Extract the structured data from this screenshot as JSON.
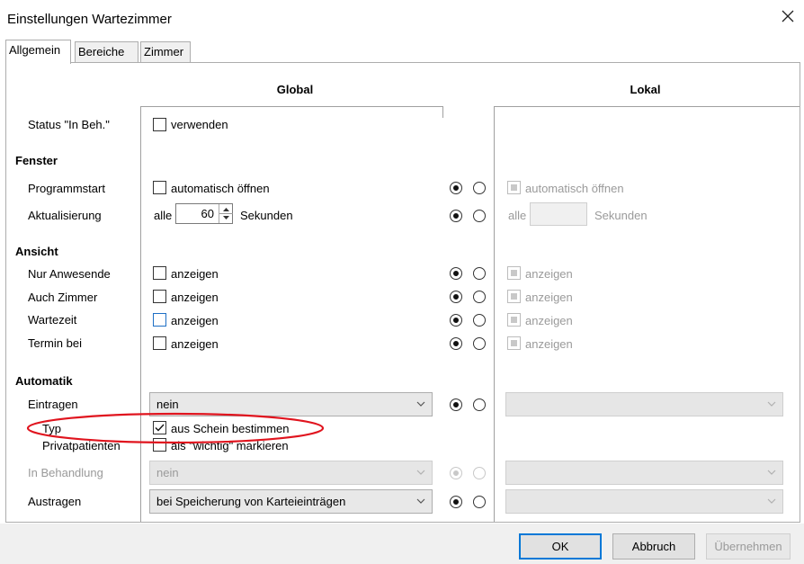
{
  "window": {
    "title": "Einstellungen Wartezimmer"
  },
  "tabs": [
    {
      "label": "Allgemein"
    },
    {
      "label": "Bereiche"
    },
    {
      "label": "Zimmer"
    }
  ],
  "columns": {
    "global": "Global",
    "lokal": "Lokal"
  },
  "rows": {
    "status": {
      "label": "Status \"In Beh.\"",
      "global_cb": "verwenden"
    },
    "fenster": "Fenster",
    "programmstart": {
      "label": "Programmstart",
      "global_cb": "automatisch öffnen",
      "local_cb": "automatisch öffnen"
    },
    "aktualisierung": {
      "label": "Aktualisierung",
      "prefix": "alle",
      "value": "60",
      "suffix": "Sekunden",
      "local_prefix": "alle",
      "local_suffix": "Sekunden"
    },
    "ansicht": "Ansicht",
    "nur_anwesende": {
      "label": "Nur Anwesende",
      "global_cb": "anzeigen",
      "local_cb": "anzeigen"
    },
    "auch_zimmer": {
      "label": "Auch Zimmer",
      "global_cb": "anzeigen",
      "local_cb": "anzeigen"
    },
    "wartezeit": {
      "label": "Wartezeit",
      "global_cb": "anzeigen",
      "local_cb": "anzeigen"
    },
    "termin_bei": {
      "label": "Termin bei",
      "global_cb": "anzeigen",
      "local_cb": "anzeigen"
    },
    "automatik": "Automatik",
    "eintragen": {
      "label": "Eintragen",
      "value": "nein"
    },
    "typ": {
      "label": "Typ",
      "global_cb": "aus Schein bestimmen"
    },
    "privatpatienten": {
      "label": "Privatpatienten",
      "global_cb": "als \"wichtig\" markieren"
    },
    "in_behandlung": {
      "label": "In Behandlung",
      "value": "nein"
    },
    "austragen": {
      "label": "Austragen",
      "value": "bei Speicherung von Karteieinträgen"
    }
  },
  "buttons": {
    "ok": "OK",
    "cancel": "Abbruch",
    "apply": "Übernehmen"
  },
  "colors": {
    "accent": "#0078d7",
    "annotation": "#e0141e",
    "disabled": "#9a9a9a"
  }
}
